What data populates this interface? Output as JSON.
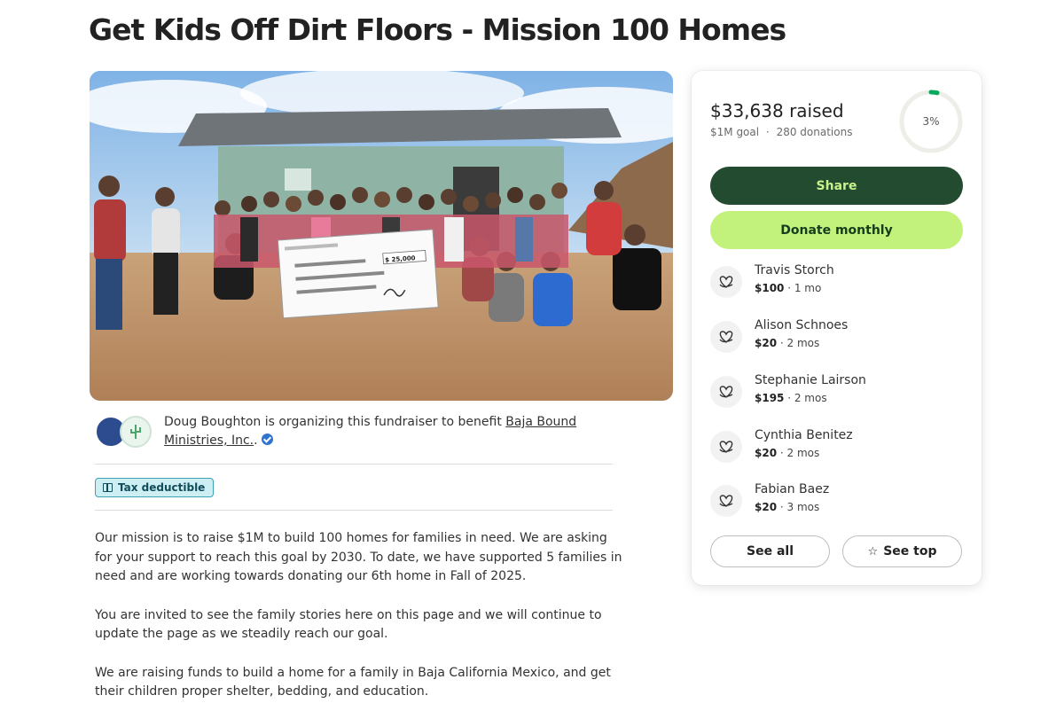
{
  "title": "Get Kids Off Dirt Floors - Mission 100 Homes",
  "organizer": {
    "text": "Doug Boughton is organizing this fundraiser to benefit",
    "beneficiary": "Baja Bound Ministries, Inc.",
    "suffix": "."
  },
  "badge": {
    "label": "Tax deductible",
    "icon": "gift-icon"
  },
  "story": [
    "Our mission is to raise $1M to build 100 homes for families in need. We are asking for your support to reach this goal by 2030. To date, we have supported 5 families in need and are working towards donating our 6th home in Fall of 2025.",
    "You are invited to see the family stories here on this page and we will continue to update the page as we steadily reach our goal.",
    "We are raising funds to build a home for a family in Baja California Mexico, and get their children proper shelter, bedding, and education."
  ],
  "check": {
    "amount": "$ 25,000"
  },
  "campaign": {
    "raised": "$33,638 raised",
    "goal": "$1M goal",
    "separator": "·",
    "donations": "280 donations",
    "progress_label": "3%",
    "progress_fraction": 0.034
  },
  "buttons": {
    "share": "Share",
    "donate_monthly": "Donate monthly",
    "see_all": "See all",
    "see_top": "See top"
  },
  "donors": [
    {
      "name": "Travis Storch",
      "amount": "$100",
      "time": " · 1 mo"
    },
    {
      "name": "Alison Schnoes",
      "amount": "$20",
      "time": " · 2 mos"
    },
    {
      "name": "Stephanie Lairson",
      "amount": "$195",
      "time": " · 2 mos"
    },
    {
      "name": "Cynthia Benitez",
      "amount": "$20",
      "time": " · 2 mos"
    },
    {
      "name": "Fabian Baez",
      "amount": "$20",
      "time": " · 3 mos"
    }
  ],
  "colors": {
    "brand_dark": "#234b30",
    "brand_light": "#c3f27c",
    "progress": "#02a95c"
  }
}
